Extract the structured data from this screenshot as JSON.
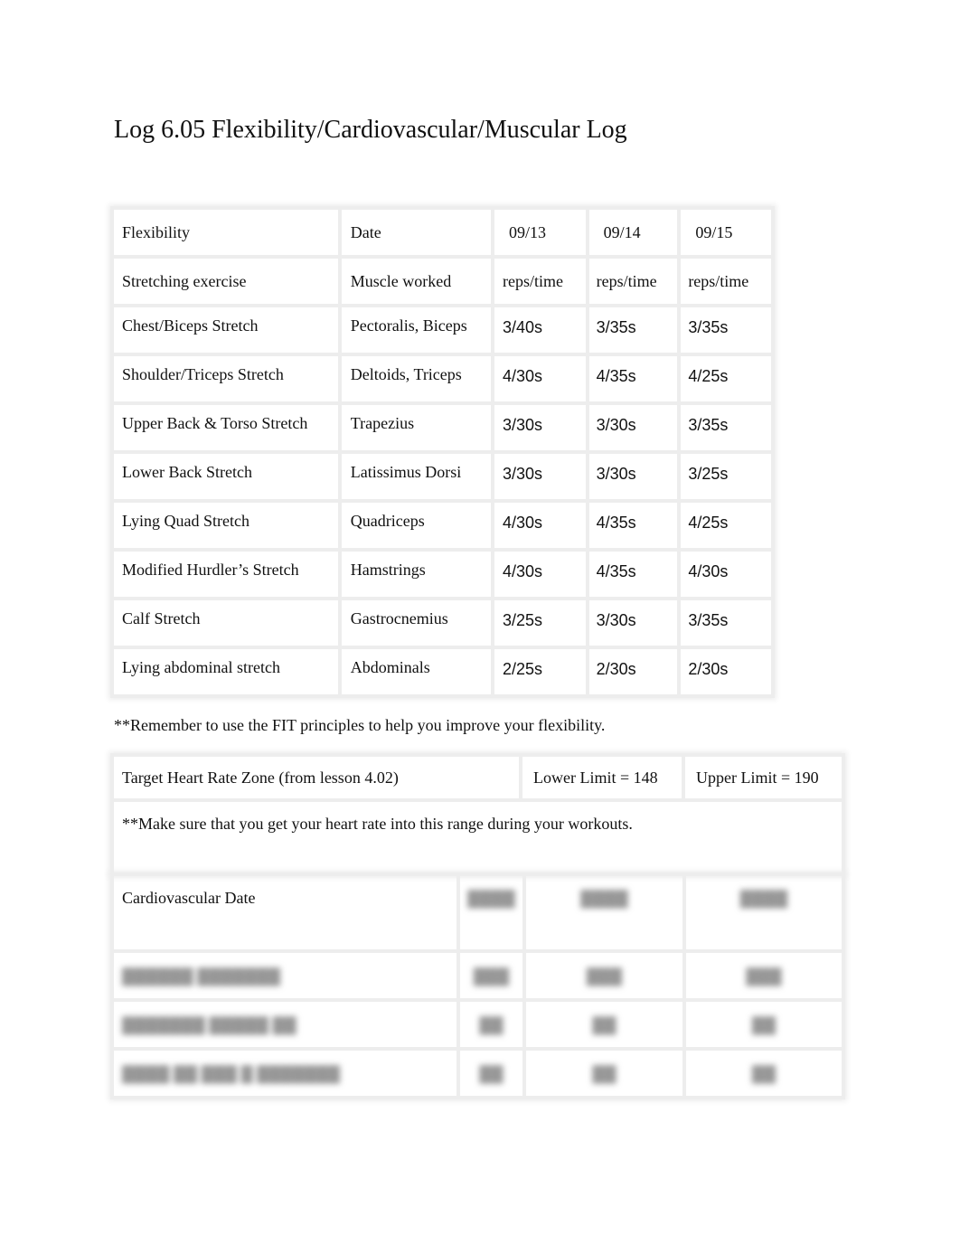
{
  "document": {
    "title": "Log 6.05 Flexibility/Cardiovascular/Muscular Log"
  },
  "flexibility_table": {
    "header": {
      "label": "Flexibility",
      "date_label": "Date",
      "dates": [
        "09/13",
        "09/14",
        "09/15"
      ]
    },
    "subheader": {
      "exercise_label": "Stretching exercise",
      "muscle_label": "Muscle worked",
      "metric_labels": [
        "reps/time",
        "reps/time",
        "reps/time"
      ]
    },
    "rows": [
      {
        "exercise": "Chest/Biceps Stretch",
        "muscle": "Pectoralis, Biceps",
        "values": [
          "3/40s",
          "3/35s",
          "3/35s"
        ]
      },
      {
        "exercise": "Shoulder/Triceps Stretch",
        "muscle": "Deltoids, Triceps",
        "values": [
          "4/30s",
          "4/35s",
          "4/25s"
        ]
      },
      {
        "exercise": "Upper Back & Torso Stretch",
        "muscle": "Trapezius",
        "values": [
          "3/30s",
          "3/30s",
          "3/35s"
        ]
      },
      {
        "exercise": "Lower Back Stretch",
        "muscle": "Latissimus Dorsi",
        "values": [
          "3/30s",
          "3/30s",
          "3/25s"
        ]
      },
      {
        "exercise": "Lying Quad Stretch",
        "muscle": "Quadriceps",
        "values": [
          "4/30s",
          "4/35s",
          "4/25s"
        ]
      },
      {
        "exercise": "Modified Hurdler’s Stretch",
        "muscle": "Hamstrings",
        "values": [
          "4/30s",
          "4/35s",
          "4/30s"
        ]
      },
      {
        "exercise": "Calf Stretch",
        "muscle": "Gastrocnemius",
        "values": [
          "3/25s",
          "3/30s",
          "3/35s"
        ]
      },
      {
        "exercise": "Lying abdominal stretch",
        "muscle": "Abdominals",
        "values": [
          "2/25s",
          "2/30s",
          "2/30s"
        ]
      }
    ]
  },
  "flexibility_note": "**Remember to use the FIT principles to help you improve your flexibility.",
  "heart_rate": {
    "zone_label": "Target Heart Rate Zone (from lesson 4.02)",
    "lower_limit": "Lower Limit = 148",
    "upper_limit": "Upper Limit = 190",
    "note": "**Make sure that you get your heart rate into this range during your workouts."
  },
  "cardio_table": {
    "header_label": "Cardiovascular Date",
    "obscured_dates": [
      "▓▓▓▓",
      "▓▓▓▓",
      "▓▓▓▓"
    ],
    "obscured_rows": [
      {
        "label": "▓▓▓▓▓▓ ▓▓▓▓▓▓▓",
        "values": [
          "▓▓▓",
          "▓▓▓",
          "▓▓▓"
        ]
      },
      {
        "label": "▓▓▓▓▓▓▓ ▓▓▓▓▓ ▓▓",
        "values": [
          "▓▓",
          "▓▓",
          "▓▓"
        ]
      },
      {
        "label": "▓▓▓▓ ▓▓ ▓▓▓ ▓ ▓▓▓▓▓▓▓",
        "values": [
          "▓▓",
          "▓▓",
          "▓▓"
        ]
      }
    ]
  }
}
